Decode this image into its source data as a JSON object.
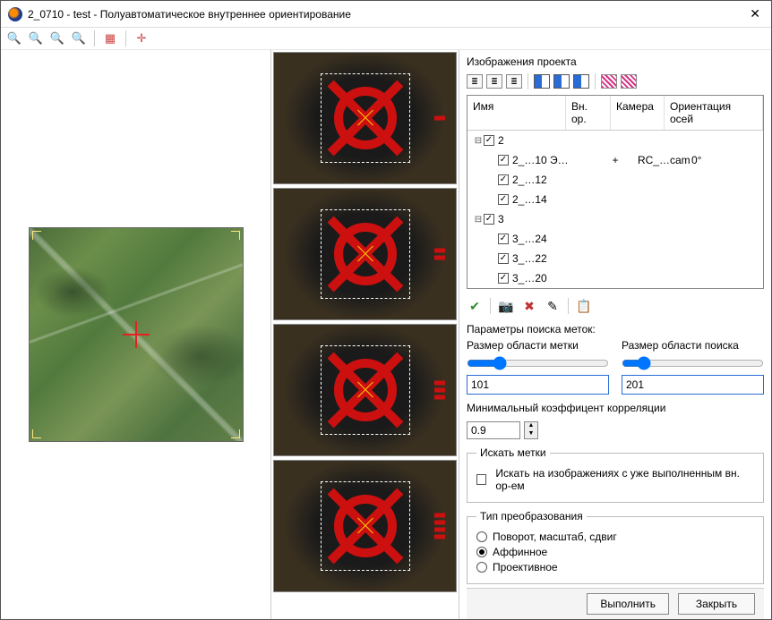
{
  "window": {
    "title": "2_0710 - test - Полуавтоматическое внутреннее ориентирование"
  },
  "section": {
    "images_label": "Изображения проекта"
  },
  "table": {
    "headers": {
      "name": "Имя",
      "vnor": "Вн. ор.",
      "camera": "Камера",
      "orient": "Ориентация осей"
    },
    "groups": [
      {
        "label": "2",
        "rows": [
          {
            "name": "2_…10  Э…",
            "vnor": "+",
            "camera": "RC_…cam",
            "orient": "0°"
          },
          {
            "name": "2_…12"
          },
          {
            "name": "2_…14"
          }
        ]
      },
      {
        "label": "3",
        "rows": [
          {
            "name": "3_…24"
          },
          {
            "name": "3_…22"
          },
          {
            "name": "3_…20"
          }
        ]
      }
    ]
  },
  "params": {
    "heading": "Параметры поиска меток:",
    "mark_area_label": "Размер области метки",
    "mark_area_value": "101",
    "search_area_label": "Размер области поиска",
    "search_area_value": "201",
    "min_corr_label": "Минимальный коэффицент корреляции",
    "min_corr_value": "0.9"
  },
  "search_marks": {
    "legend": "Искать метки",
    "chk_label": "Искать на изображениях  с уже выполненным вн. ор-ем"
  },
  "transform": {
    "legend": "Тип преобразования",
    "opt1": "Поворот, масштаб, сдвиг",
    "opt2": "Аффинное",
    "opt3": "Проективное"
  },
  "buttons": {
    "run": "Выполнить",
    "close": "Закрыть"
  }
}
